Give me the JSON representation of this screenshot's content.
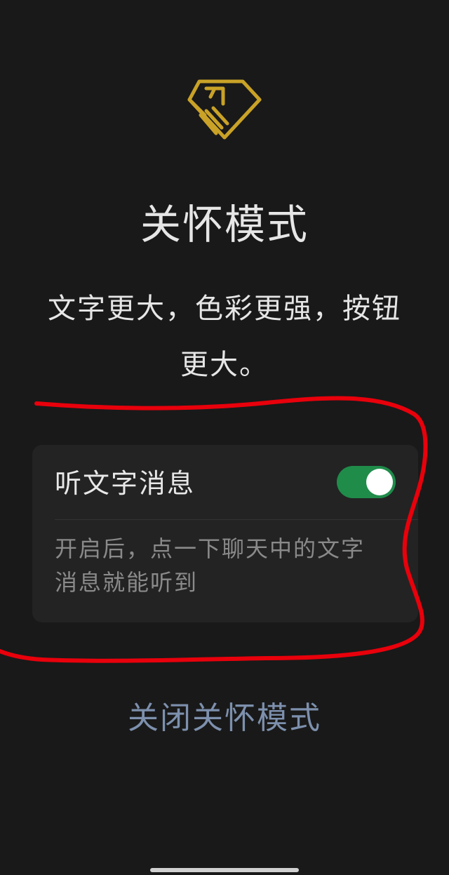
{
  "care_mode": {
    "icon": "care-hands-icon",
    "title": "关怀模式",
    "subtitle_line1": "文字更大，色彩更强，按钮",
    "subtitle_line2": "更大。"
  },
  "setting": {
    "label": "听文字消息",
    "toggle_on": true,
    "description_line1": "开启后，点一下聊天中的文字",
    "description_line2": "消息就能听到"
  },
  "close_button_label": "关闭关怀模式",
  "colors": {
    "background": "#191919",
    "accent_gold": "#c9a227",
    "toggle_green": "#1f8c4a",
    "link_blue": "#7d90ad",
    "annotation_red": "#e8000b"
  }
}
